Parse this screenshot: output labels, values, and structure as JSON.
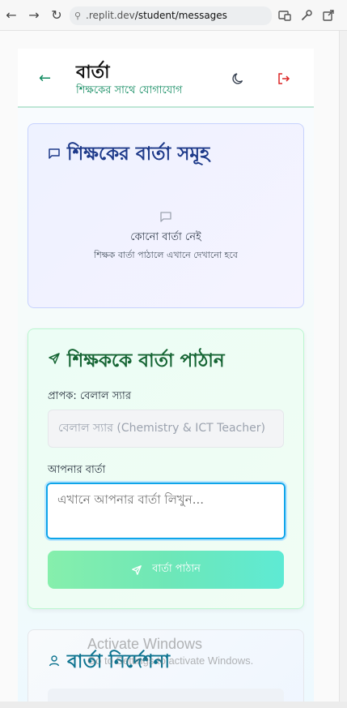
{
  "browser": {
    "url_prefix": ".replit.dev",
    "url_path": "/student/messages"
  },
  "header": {
    "title": "বার্তা",
    "subtitle": "শিক্ষকের সাথে যোগাযোগ"
  },
  "inbox": {
    "title": "শিক্ষকের বার্তা সমূহ",
    "empty_title": "কোনো বার্তা নেই",
    "empty_subtitle": "শিক্ষক বার্তা পাঠালে এখানে দেখানো হবে"
  },
  "compose": {
    "title": "শিক্ষককে বার্তা পাঠান",
    "recipient_label": "প্রাপক: বেলাল স্যার",
    "recipient_value": "বেলাল স্যার (Chemistry & ICT Teacher)",
    "message_label": "আপনার বার্তা",
    "message_placeholder": "এখানে আপনার বার্তা লিখুন...",
    "send_label": "বার্তা পাঠান"
  },
  "guidelines": {
    "title": "বার্তা নির্দেশনা"
  },
  "watermark": {
    "line1": "Activate Windows",
    "line2": "Go to Settings to activate Windows."
  },
  "colors": {
    "accent_green": "#0f8a5f",
    "logout_red": "#dc2626",
    "inbox_title": "#1e3a8a",
    "compose_title": "#166534",
    "focus_blue": "#0ea5e9"
  }
}
